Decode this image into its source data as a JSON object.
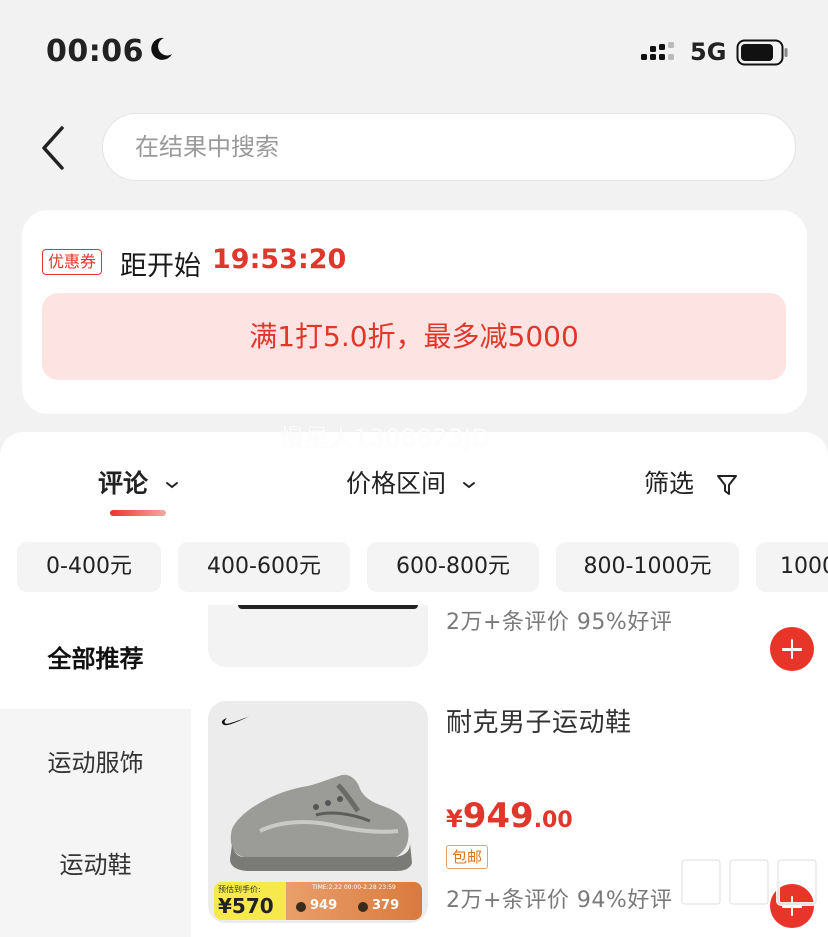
{
  "status_bar": {
    "time": "00:06",
    "network": "5G",
    "icons": [
      "moon-icon",
      "signal-icon",
      "battery-icon"
    ]
  },
  "search": {
    "placeholder": "在结果中搜索"
  },
  "coupon": {
    "tag": "优惠券",
    "countdown_label": "距开始",
    "countdown": "19:53:20",
    "banner": "满1打5.0折，最多减5000"
  },
  "watermark": "慢星人1308823JD",
  "sort_tabs": [
    {
      "label": "评论",
      "active": true
    },
    {
      "label": "价格区间",
      "active": false
    },
    {
      "label": "筛选",
      "active": false
    }
  ],
  "price_chips": [
    "0-400元",
    "400-600元",
    "600-800元",
    "800-1000元",
    "1000"
  ],
  "sidebar": {
    "items": [
      "全部推荐",
      "运动服饰",
      "运动鞋"
    ],
    "active_index": 0
  },
  "products": {
    "prev": {
      "meta": "2万+条评价  95%好评"
    },
    "main": {
      "title": "耐克男子运动鞋",
      "price_currency": "¥",
      "price_int": "949",
      "price_dec": ".00",
      "tag": "包邮",
      "meta": "2万+条评价  94%好评",
      "promo": {
        "left_label": "预估到手价:",
        "left_price": "¥570",
        "time": "TIME:2.22 00:00-2.28 23:59",
        "price_a": "949",
        "price_b": "379"
      }
    }
  },
  "colors": {
    "accent": "#e0362b",
    "banner_bg": "#fde4e2",
    "add_button": "#e8352a"
  }
}
